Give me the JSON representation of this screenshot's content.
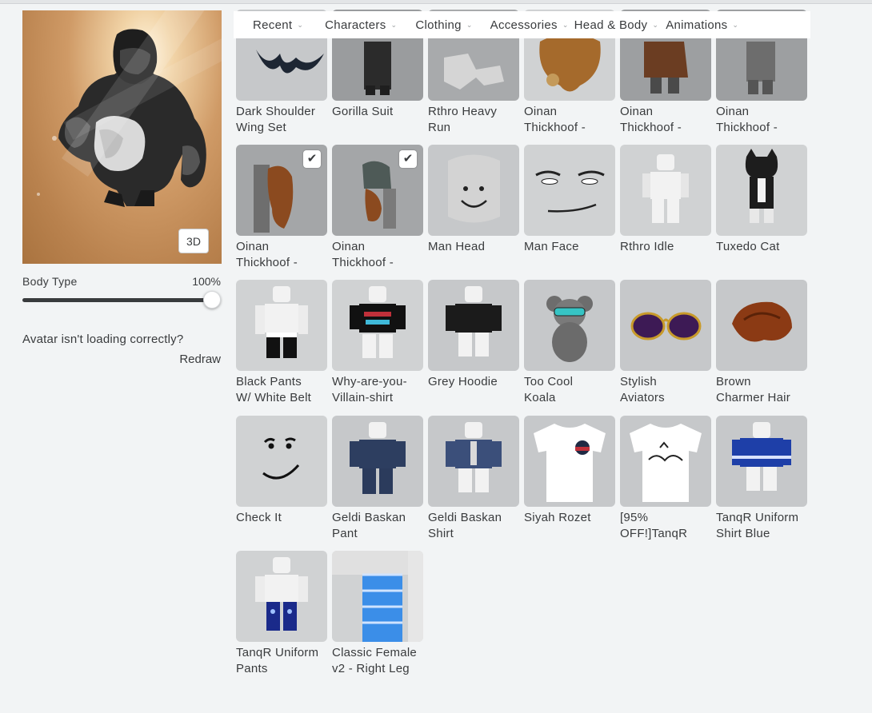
{
  "tabs": [
    {
      "label": "Recent"
    },
    {
      "label": "Characters"
    },
    {
      "label": "Clothing"
    },
    {
      "label": "Accessories"
    },
    {
      "label": "Head & Body"
    },
    {
      "label": "Animations"
    }
  ],
  "avatar": {
    "view_toggle": "3D",
    "body_type_label": "Body Type",
    "body_type_value": "100%",
    "body_type_fraction": 1.0,
    "loading_text": "Avatar isn't loading correctly?",
    "redraw_label": "Redraw"
  },
  "items": [
    {
      "name": "Dark Shoulder\nWing Set",
      "selected": false
    },
    {
      "name": "Gorilla Suit",
      "selected": false
    },
    {
      "name": "Rthro Heavy\nRun",
      "selected": false
    },
    {
      "name": "Oinan\nThickhoof -",
      "selected": false
    },
    {
      "name": "Oinan\nThickhoof -",
      "selected": false
    },
    {
      "name": "Oinan\nThickhoof -",
      "selected": false
    },
    {
      "name": "Oinan\nThickhoof -",
      "selected": true
    },
    {
      "name": "Oinan\nThickhoof -",
      "selected": true
    },
    {
      "name": "Man Head",
      "selected": false
    },
    {
      "name": "Man Face",
      "selected": false
    },
    {
      "name": "Rthro Idle",
      "selected": false
    },
    {
      "name": "Tuxedo Cat",
      "selected": false
    },
    {
      "name": "Black Pants\nW/ White Belt",
      "selected": false
    },
    {
      "name": "Why-are-you-\nVillain-shirt",
      "selected": false
    },
    {
      "name": "Grey Hoodie",
      "selected": false
    },
    {
      "name": "Too Cool\nKoala",
      "selected": false
    },
    {
      "name": "Stylish\nAviators",
      "selected": false
    },
    {
      "name": "Brown\nCharmer Hair",
      "selected": false
    },
    {
      "name": "Check It",
      "selected": false
    },
    {
      "name": "Geldi Baskan\nPant",
      "selected": false
    },
    {
      "name": "Geldi Baskan\nShirt",
      "selected": false
    },
    {
      "name": "Siyah Rozet",
      "selected": false
    },
    {
      "name": "[95%\nOFF!]TanqR",
      "selected": false
    },
    {
      "name": "TanqR Uniform\nShirt Blue",
      "selected": false
    },
    {
      "name": "TanqR Uniform\nPants",
      "selected": false
    },
    {
      "name": "Classic Female\nv2 - Right Leg",
      "selected": false
    }
  ],
  "icon_names": {
    "tab_chevron": "chevron-down-icon",
    "selected": "checkmark-icon"
  },
  "colors": {
    "background": "#f2f4f5",
    "thumb": "#c6c8ca",
    "text": "#393b3d"
  }
}
